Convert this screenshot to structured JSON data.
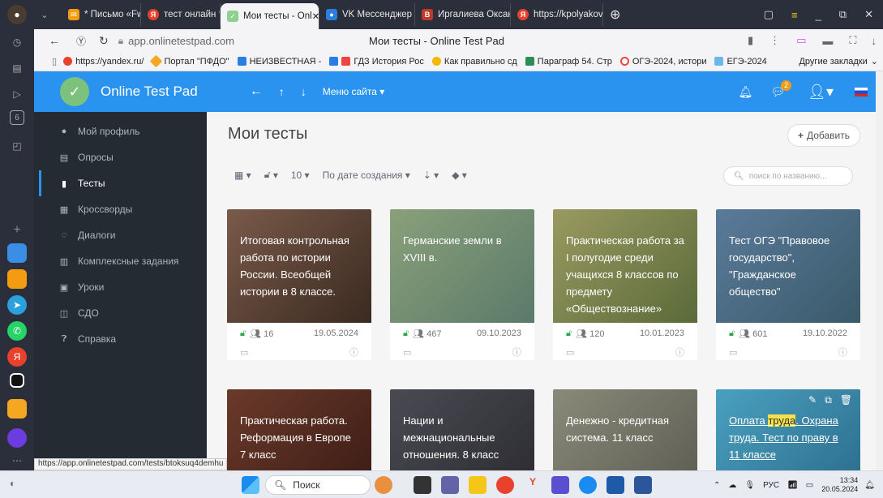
{
  "tabs": [
    {
      "label": "* Письмо «Fwd: PE"
    },
    {
      "label": "тест онлайн тест п"
    },
    {
      "label": "Мои тесты - Onl"
    },
    {
      "label": "VK Мессенджер"
    },
    {
      "label": "Иргалиева Оксана"
    },
    {
      "label": "https://kpolyakov."
    }
  ],
  "address": {
    "url": "app.onlinetestpad.com",
    "page_title": "Мои тесты - Online Test Pad"
  },
  "bookmarks": [
    {
      "label": "https://yandex.ru/"
    },
    {
      "label": "Портал \"ПФДО\""
    },
    {
      "label": "НЕИЗВЕСТНАЯ -"
    },
    {
      "label": "ГДЗ История Рос"
    },
    {
      "label": "Как правильно сд"
    },
    {
      "label": "Параграф 54. Стр"
    },
    {
      "label": "ОГЭ-2024, истори"
    },
    {
      "label": "ЕГЭ-2024"
    },
    {
      "label": "Другие закладки"
    }
  ],
  "header": {
    "brand": "Online Test Pad",
    "menu": "Меню сайта",
    "badge": "2"
  },
  "sidebar": [
    {
      "label": "Мой профиль"
    },
    {
      "label": "Опросы"
    },
    {
      "label": "Тесты"
    },
    {
      "label": "Кроссворды"
    },
    {
      "label": "Диалоги"
    },
    {
      "label": "Комплексные задания"
    },
    {
      "label": "Уроки"
    },
    {
      "label": "СДО"
    },
    {
      "label": "Справка"
    }
  ],
  "main": {
    "title": "Мои тесты",
    "add_label": "Добавить",
    "count": "10",
    "sort": "По дате создания",
    "search_placeholder": "поиск по названию..."
  },
  "cards": [
    {
      "title": "Итоговая контрольная работа по истории России. Всеобщей истории в 8 классе.",
      "count": "16",
      "date": "19.05.2024",
      "bg": "#6b4a3a"
    },
    {
      "title": "Германские земли в XVIII в.",
      "count": "467",
      "date": "09.10.2023",
      "bg": "#6f8a6a"
    },
    {
      "title": "Практическая работа за I полугодие среди учащихся 8 классов по предмету «Обществознание»",
      "count": "120",
      "date": "10.01.2023",
      "bg": "#8a8a55"
    },
    {
      "title": "Тест ОГЭ \"Правовое государство\", \"Гражданское общество\"",
      "count": "601",
      "date": "19.10.2022",
      "bg": "#4a6c8a"
    },
    {
      "title": "Практическая работа. Реформация в Европе 7 класс",
      "bg": "#5a2a22"
    },
    {
      "title": "Нации и межнациональные отношения. 8 класс",
      "bg": "#3a3a40"
    },
    {
      "title": "Денежно - кредитная система. 11 класс",
      "bg": "#7a7a6a"
    },
    {
      "title_a": "Оплата ",
      "title_b": "труда",
      "title_c": ". Охрана труда. Тест по праву в 11 классе",
      "bg": "#3c8fb0"
    }
  ],
  "status_url": "https://app.onlinetestpad.com/tests/btoksuq4demhu",
  "taskbar": {
    "search": "Поиск",
    "lang": "РУС",
    "time": "13:34",
    "date": "20.05.2024"
  }
}
